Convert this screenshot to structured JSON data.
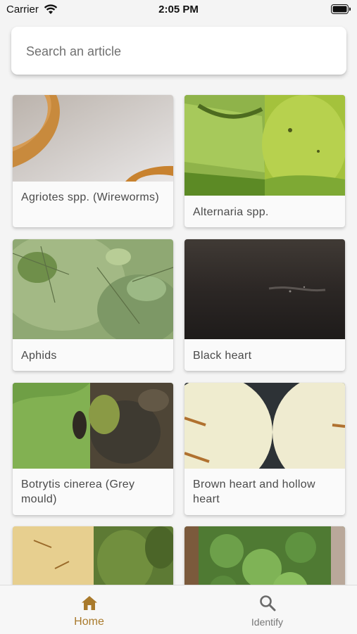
{
  "status_bar": {
    "carrier": "Carrier",
    "time": "2:05 PM"
  },
  "search": {
    "placeholder": "Search an article"
  },
  "articles": [
    {
      "title": "Agriotes spp. (Wireworms)"
    },
    {
      "title": "Alternaria spp."
    },
    {
      "title": "Aphids"
    },
    {
      "title": "Black heart"
    },
    {
      "title": "Botrytis cinerea (Grey mould)"
    },
    {
      "title": "Brown heart and hollow heart"
    }
  ],
  "tab_bar": {
    "tabs": [
      {
        "label": "Home",
        "icon": "home-icon",
        "active": true
      },
      {
        "label": "Identify",
        "icon": "search-icon",
        "active": false
      }
    ]
  },
  "colors": {
    "accent": "#a97a2c"
  }
}
